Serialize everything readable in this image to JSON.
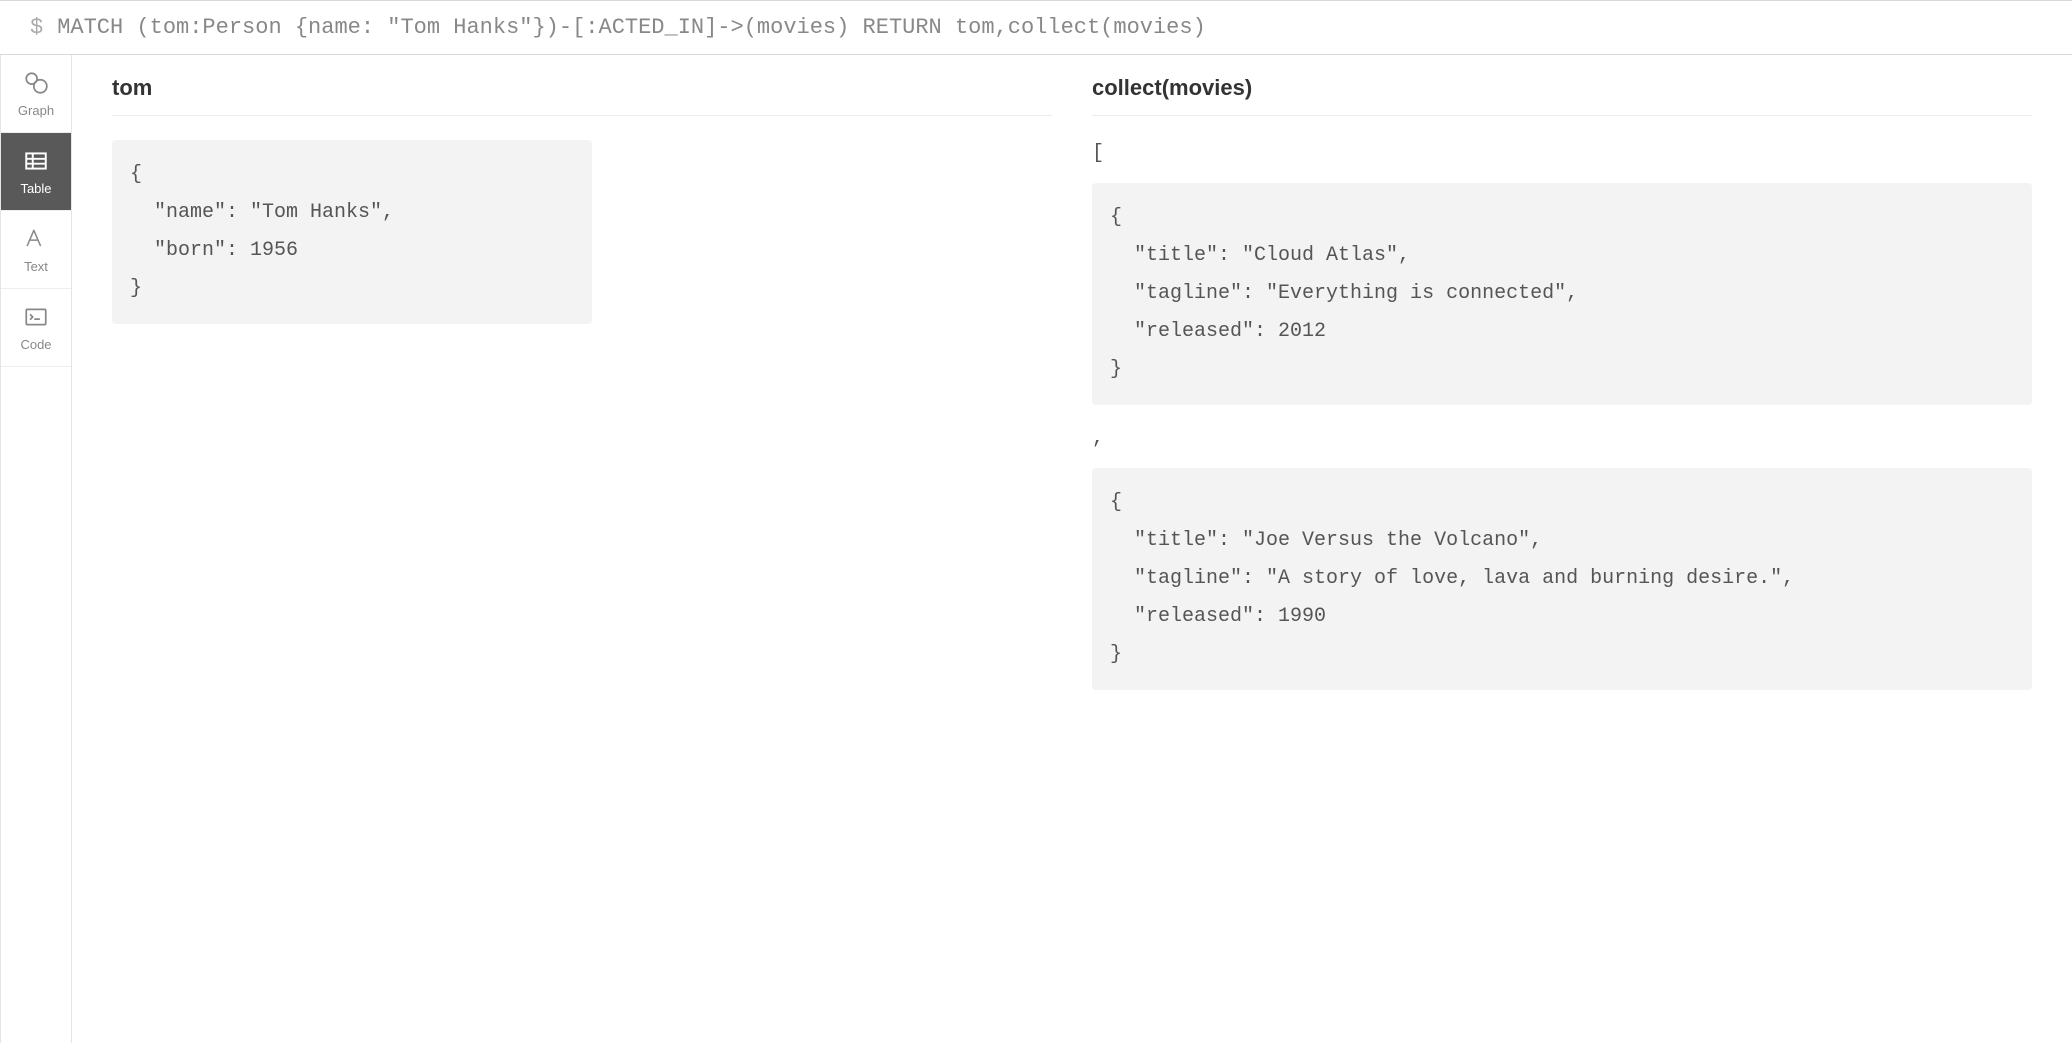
{
  "query": {
    "prompt": "$",
    "text": "MATCH (tom:Person {name: \"Tom Hanks\"})-[:ACTED_IN]->(movies) RETURN tom,collect(movies)"
  },
  "sidebar": {
    "items": [
      {
        "id": "graph",
        "label": "Graph",
        "active": false
      },
      {
        "id": "table",
        "label": "Table",
        "active": true
      },
      {
        "id": "text",
        "label": "Text",
        "active": false
      },
      {
        "id": "code",
        "label": "Code",
        "active": false
      }
    ]
  },
  "columns": {
    "tom": {
      "header": "tom",
      "block": "{\n  \"name\": \"Tom Hanks\",\n  \"born\": 1956\n}"
    },
    "collect": {
      "header": "collect(movies)",
      "open_bracket": "[",
      "comma": ",",
      "blocks": [
        "{\n  \"title\": \"Cloud Atlas\",\n  \"tagline\": \"Everything is connected\",\n  \"released\": 2012\n}",
        "{\n  \"title\": \"Joe Versus the Volcano\",\n  \"tagline\": \"A story of love, lava and burning desire.\",\n  \"released\": 1990\n}"
      ]
    }
  }
}
